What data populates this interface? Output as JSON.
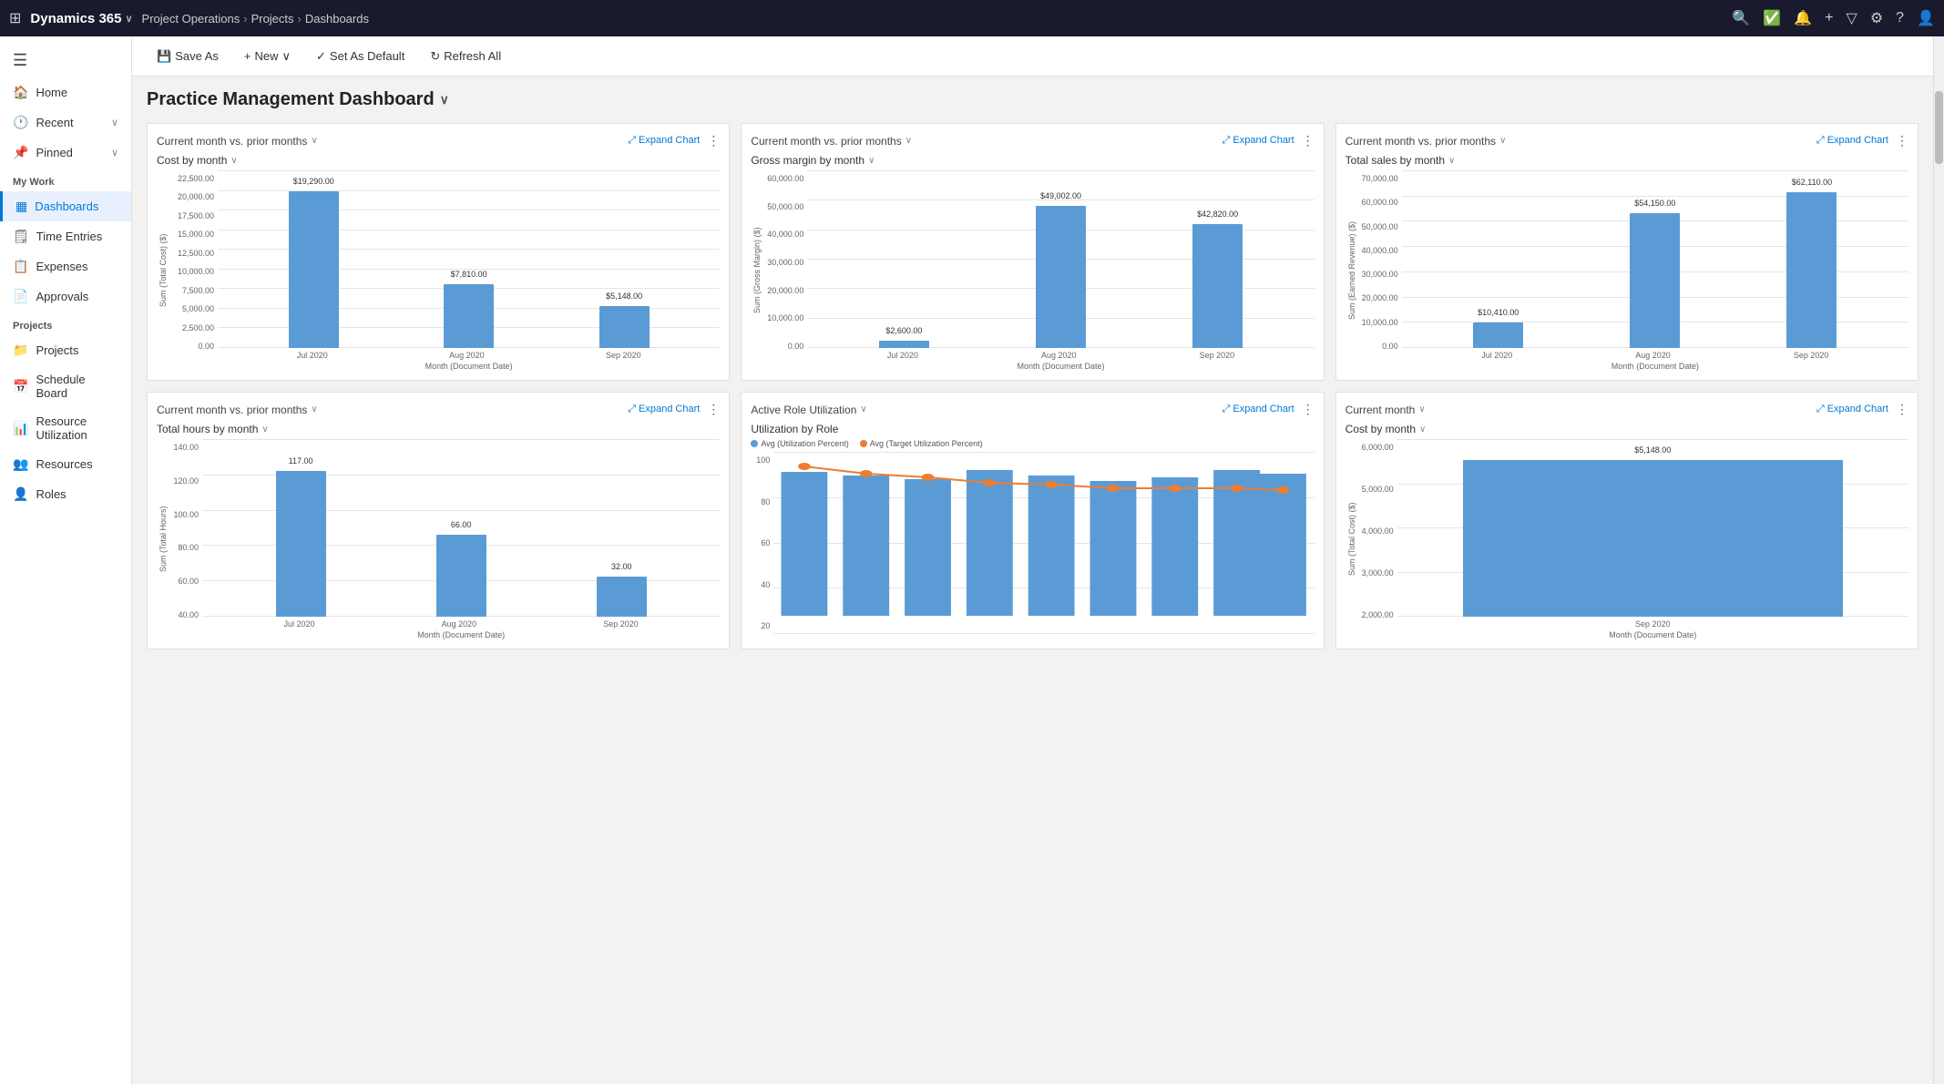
{
  "app": {
    "name": "Dynamics 365",
    "chevron": "∨",
    "module": "Project Operations",
    "breadcrumb": [
      "Projects",
      "Dashboards"
    ]
  },
  "nav_icons": [
    "🔍",
    "✅",
    "🔔",
    "+",
    "▽",
    "⚙",
    "?",
    "👤"
  ],
  "toolbar": {
    "save_as": "Save As",
    "new": "New",
    "set_default": "Set As Default",
    "refresh_all": "Refresh All"
  },
  "dashboard": {
    "title": "Practice Management Dashboard"
  },
  "sidebar": {
    "hamburger": "☰",
    "items": [
      {
        "label": "Home",
        "icon": "🏠",
        "active": false
      },
      {
        "label": "Recent",
        "icon": "🕐",
        "has_chevron": true,
        "active": false
      },
      {
        "label": "Pinned",
        "icon": "📌",
        "has_chevron": true,
        "active": false
      }
    ],
    "my_work": {
      "label": "My Work",
      "items": [
        {
          "label": "Dashboards",
          "icon": "📊",
          "active": true
        },
        {
          "label": "Time Entries",
          "icon": "🗒",
          "active": false
        },
        {
          "label": "Expenses",
          "icon": "📋",
          "active": false
        },
        {
          "label": "Approvals",
          "icon": "📄",
          "active": false
        }
      ]
    },
    "projects": {
      "label": "Projects",
      "items": [
        {
          "label": "Projects",
          "icon": "📁",
          "active": false
        },
        {
          "label": "Schedule Board",
          "icon": "📅",
          "active": false
        },
        {
          "label": "Resource Utilization",
          "icon": "📊",
          "active": false
        },
        {
          "label": "Resources",
          "icon": "👥",
          "active": false
        },
        {
          "label": "Roles",
          "icon": "👤",
          "active": false
        }
      ]
    }
  },
  "charts": {
    "row1": [
      {
        "id": "cost_by_month",
        "header_label": "Current month vs. prior months",
        "expand": "Expand Chart",
        "subtitle": "Cost by month",
        "y_max": "22,500.00",
        "y_labels": [
          "22,500.00",
          "20,000.00",
          "17,500.00",
          "15,000.00",
          "12,500.00",
          "10,000.00",
          "7,500.00",
          "5,000.00",
          "2,500.00",
          "0.00"
        ],
        "y_axis_title": "Sum (Total Cost) ($)",
        "x_labels": [
          "Jul 2020",
          "Aug 2020",
          "Sep 2020"
        ],
        "x_axis_title": "Month (Document Date)",
        "bars": [
          {
            "value": "$19,290.00",
            "height_pct": 86
          },
          {
            "value": "$7,810.00",
            "height_pct": 35
          },
          {
            "value": "$5,148.00",
            "height_pct": 23
          }
        ]
      },
      {
        "id": "gross_margin_by_month",
        "header_label": "Current month vs. prior months",
        "expand": "Expand Chart",
        "subtitle": "Gross margin by month",
        "y_max": "60,000.00",
        "y_labels": [
          "60,000.00",
          "50,000.00",
          "40,000.00",
          "30,000.00",
          "20,000.00",
          "10,000.00",
          "0.00"
        ],
        "y_axis_title": "Sum (Gross Margin) ($)",
        "x_labels": [
          "Jul 2020",
          "Aug 2020",
          "Sep 2020"
        ],
        "x_axis_title": "Month (Document Date)",
        "bars": [
          {
            "value": "$2,600.00",
            "height_pct": 4
          },
          {
            "value": "$49,002.00",
            "height_pct": 82
          },
          {
            "value": "$42,820.00",
            "height_pct": 71
          }
        ]
      },
      {
        "id": "total_sales_by_month",
        "header_label": "Current month vs. prior months",
        "expand": "Expand Chart",
        "subtitle": "Total sales by month",
        "y_max": "70,000.00",
        "y_labels": [
          "70,000.00",
          "60,000.00",
          "50,000.00",
          "40,000.00",
          "30,000.00",
          "20,000.00",
          "10,000.00",
          "0.00"
        ],
        "y_axis_title": "Sum (Earned Revenue) ($)",
        "x_labels": [
          "Jul 2020",
          "Aug 2020",
          "Sep 2020"
        ],
        "x_axis_title": "Month (Document Date)",
        "bars": [
          {
            "value": "$10,410.00",
            "height_pct": 15
          },
          {
            "value": "$54,150.00",
            "height_pct": 77
          },
          {
            "value": "$62,110.00",
            "height_pct": 89
          }
        ]
      }
    ],
    "row2": [
      {
        "id": "total_hours_by_month",
        "header_label": "Current month vs. prior months",
        "expand": "Expand Chart",
        "subtitle": "Total hours by month",
        "y_max": "140.00",
        "y_labels": [
          "140.00",
          "120.00",
          "100.00",
          "80.00",
          "60.00",
          "40.00"
        ],
        "y_axis_title": "Sum (Total Hours)",
        "x_labels": [
          "Jul 2020",
          "Aug 2020",
          "Sep 2020"
        ],
        "x_axis_title": "Month (Document Date)",
        "bars": [
          {
            "value": "117.00",
            "height_pct": 84
          },
          {
            "value": "66.00",
            "height_pct": 47
          },
          {
            "value": "32.00",
            "height_pct": 23
          }
        ]
      },
      {
        "id": "active_role_utilization",
        "header_label": "Active Role Utilization",
        "expand": "Expand Chart",
        "subtitle": "Utilization by Role",
        "legend": [
          {
            "label": "Avg (Utilization Percent)",
            "color": "#5b9bd5"
          },
          {
            "label": "Avg (Target Utilization Percent)",
            "color": "#ed7d31"
          }
        ],
        "y_labels": [
          "100",
          "80",
          "60",
          "40",
          "20"
        ],
        "bars": [
          89,
          87,
          85,
          90,
          87,
          84,
          86,
          90,
          88
        ],
        "line_points": [
          92,
          88,
          86,
          83,
          82,
          80,
          80,
          80,
          79
        ]
      },
      {
        "id": "current_month_cost",
        "header_label": "Current month",
        "expand": "Expand Chart",
        "subtitle": "Cost by month",
        "y_max": "6,000.00",
        "y_labels": [
          "6,000.00",
          "5,000.00",
          "4,000.00",
          "3,000.00",
          "2,000.00"
        ],
        "y_axis_title": "Sum (Total Cost) ($)",
        "bars": [
          {
            "value": "$5,148.00",
            "height_pct": 86
          }
        ]
      }
    ]
  }
}
